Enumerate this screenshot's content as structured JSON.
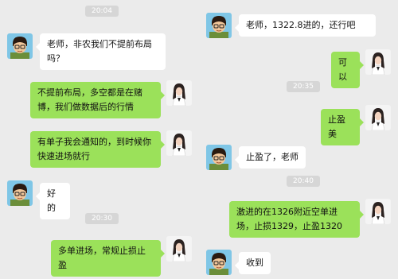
{
  "colors": {
    "background": "#ebebeb",
    "bubble_in": "#ffffff",
    "bubble_out": "#9be15a",
    "timestamp_bg": "#d6d6d6"
  },
  "left_panel": {
    "timestamps": [
      "20:04",
      "20:30"
    ],
    "messages": [
      {
        "text": "老师，非农我们不提前布局吗？",
        "sender": "student",
        "avatar_icon": "student-avatar-icon"
      },
      {
        "text": "不提前布局，多空都是在赌博，我们做数据后的行情",
        "sender": "teacher",
        "avatar_icon": "teacher-avatar-icon"
      },
      {
        "text": "有单子我会通知的，到时候你快速进场就行",
        "sender": "teacher",
        "avatar_icon": "teacher-avatar-icon"
      },
      {
        "text": "好的",
        "sender": "student",
        "avatar_icon": "student-avatar-icon"
      },
      {
        "text": "多单进场，常规止损止盈",
        "sender": "teacher",
        "avatar_icon": "teacher-avatar-icon"
      }
    ]
  },
  "right_panel": {
    "timestamps": [
      "20:35",
      "20:40"
    ],
    "messages": [
      {
        "text": "老师，1322.8进的，还行吧",
        "sender": "student",
        "avatar_icon": "student-avatar-icon"
      },
      {
        "text": "可以",
        "sender": "teacher",
        "avatar_icon": "teacher-avatar-icon"
      },
      {
        "text": "止盈美",
        "sender": "teacher",
        "avatar_icon": "teacher-avatar-icon"
      },
      {
        "text": "止盈了，老师",
        "sender": "student",
        "avatar_icon": "student-avatar-icon"
      },
      {
        "text": "激进的在1326附近空单进场，止损1329，止盈1320",
        "sender": "teacher",
        "avatar_icon": "teacher-avatar-icon"
      },
      {
        "text": "收到",
        "sender": "student",
        "avatar_icon": "student-avatar-icon"
      }
    ]
  }
}
